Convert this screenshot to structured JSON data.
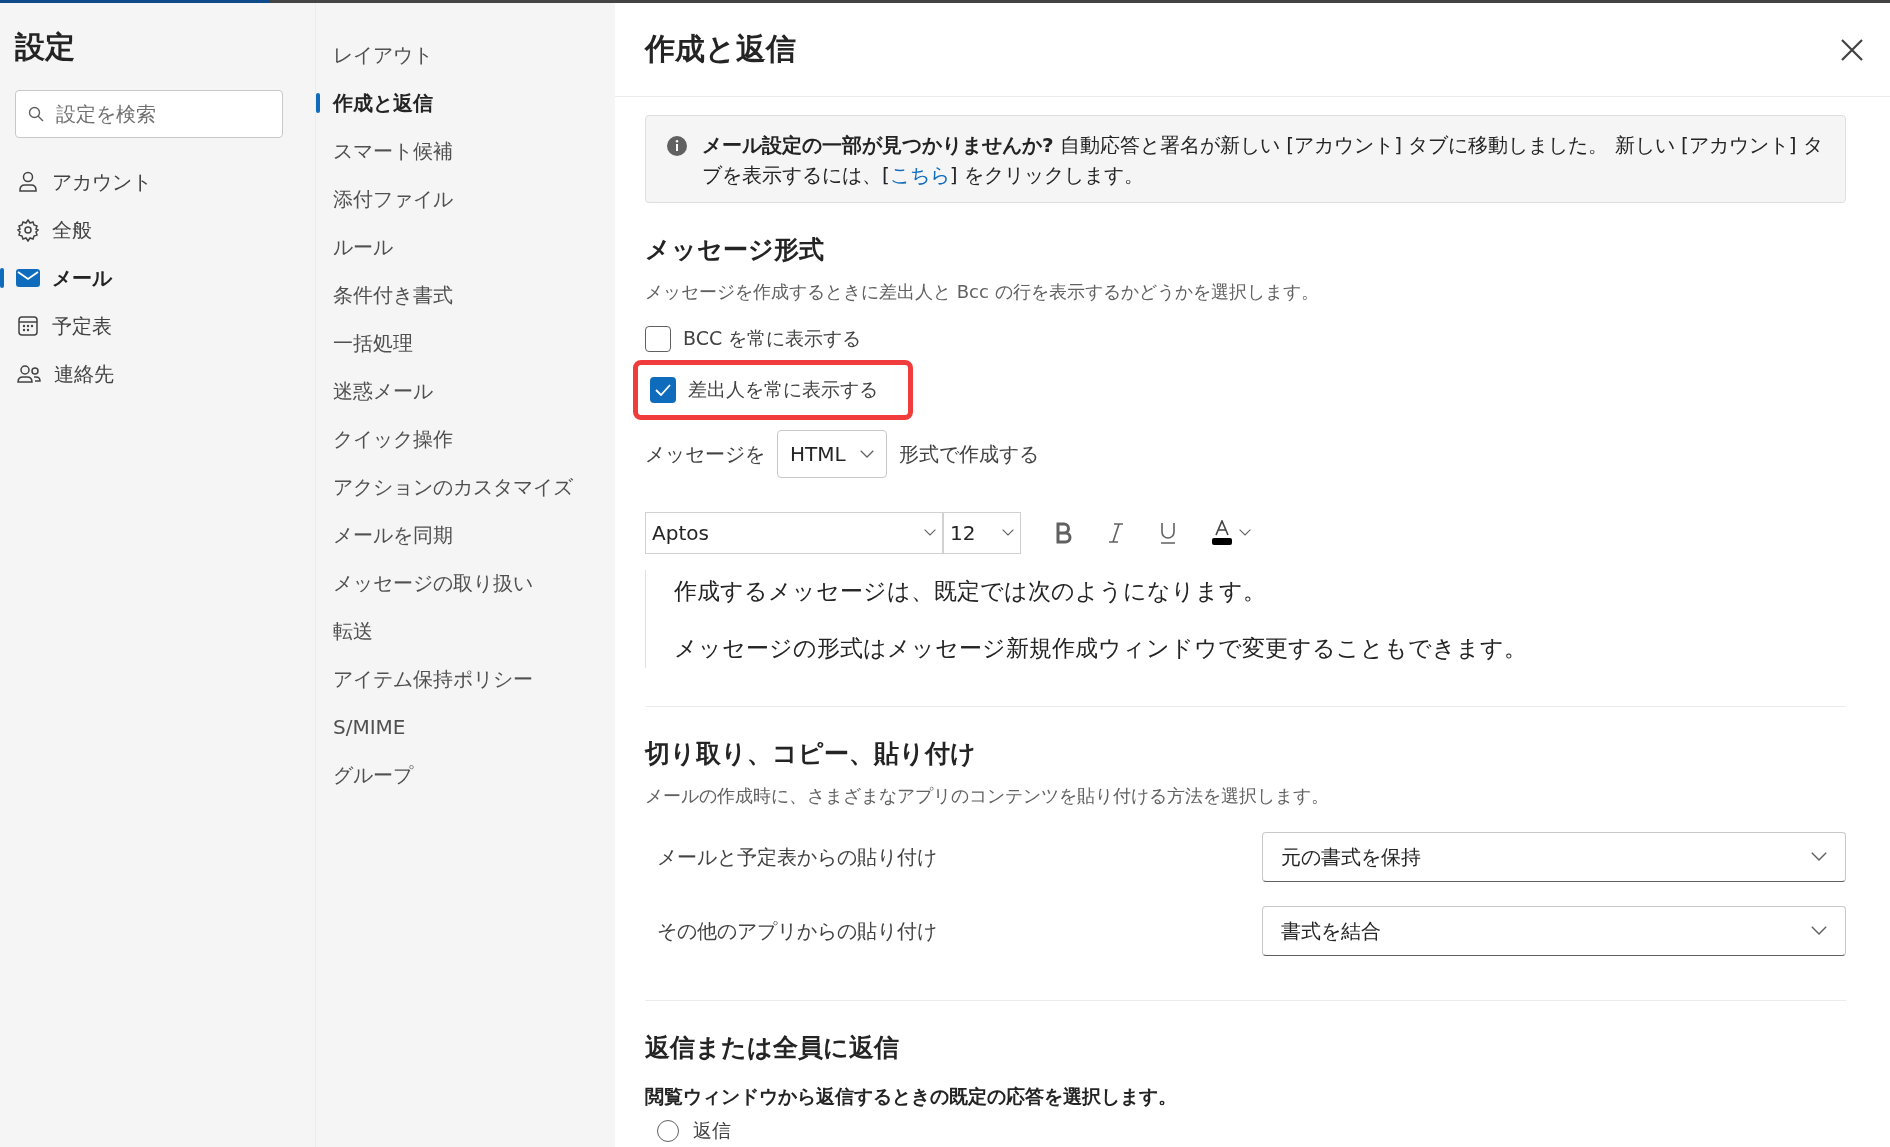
{
  "sidebar": {
    "title": "設定",
    "search": {
      "placeholder": "設定を検索"
    },
    "items": [
      {
        "label": "アカウント",
        "selected": false
      },
      {
        "label": "全般",
        "selected": false
      },
      {
        "label": "メール",
        "selected": true
      },
      {
        "label": "予定表",
        "selected": false
      },
      {
        "label": "連絡先",
        "selected": false
      }
    ]
  },
  "subnav": {
    "items": [
      {
        "label": "レイアウト",
        "selected": false
      },
      {
        "label": "作成と返信",
        "selected": true
      },
      {
        "label": "スマート候補",
        "selected": false
      },
      {
        "label": "添付ファイル",
        "selected": false
      },
      {
        "label": "ルール",
        "selected": false
      },
      {
        "label": "条件付き書式",
        "selected": false
      },
      {
        "label": "一括処理",
        "selected": false
      },
      {
        "label": "迷惑メール",
        "selected": false
      },
      {
        "label": "クイック操作",
        "selected": false
      },
      {
        "label": "アクションのカスタマイズ",
        "selected": false
      },
      {
        "label": "メールを同期",
        "selected": false
      },
      {
        "label": "メッセージの取り扱い",
        "selected": false
      },
      {
        "label": "転送",
        "selected": false
      },
      {
        "label": "アイテム保持ポリシー",
        "selected": false
      },
      {
        "label": "S/MIME",
        "selected": false
      },
      {
        "label": "グループ",
        "selected": false
      }
    ]
  },
  "panel": {
    "title": "作成と返信",
    "notice": {
      "text": "**メール設定の一部が見つかりませんか?** 自動応答と署名が新しい [アカウント] タブに移動しました。 新しい [アカウント] タブを表示するには、[",
      "link": "こちら",
      "after": "] をクリックします。"
    },
    "message_format": {
      "heading": "メッセージ形式",
      "description": "メッセージを作成するときに差出人と Bcc の行を表示するかどうかを選択します。",
      "checkboxes": [
        {
          "label": "BCC を常に表示する",
          "checked": false,
          "highlighted": false
        },
        {
          "label": "差出人を常に表示する",
          "checked": true,
          "highlighted": true
        }
      ],
      "format_prefix": "メッセージを",
      "format_value": "HTML",
      "format_suffix": "形式で作成する",
      "font": "Aptos",
      "size": "12",
      "preview": [
        "作成するメッセージは、既定では次のようになります。",
        "メッセージの形式はメッセージ新規作成ウィンドウで変更することもできます。"
      ]
    },
    "paste": {
      "heading": "切り取り、コピー、貼り付け",
      "description": "メールの作成時に、さまざまなアプリのコンテンツを貼り付ける方法を選択します。",
      "rows": [
        {
          "label": "メールと予定表からの貼り付け",
          "value": "元の書式を保持"
        },
        {
          "label": "その他のアプリからの貼り付け",
          "value": "書式を結合"
        }
      ]
    },
    "reply": {
      "heading": "返信または全員に返信",
      "description": "閲覧ウィンドウから返信するときの既定の応答を選択します。",
      "options": [
        {
          "label": "返信",
          "selected": false
        }
      ]
    }
  }
}
